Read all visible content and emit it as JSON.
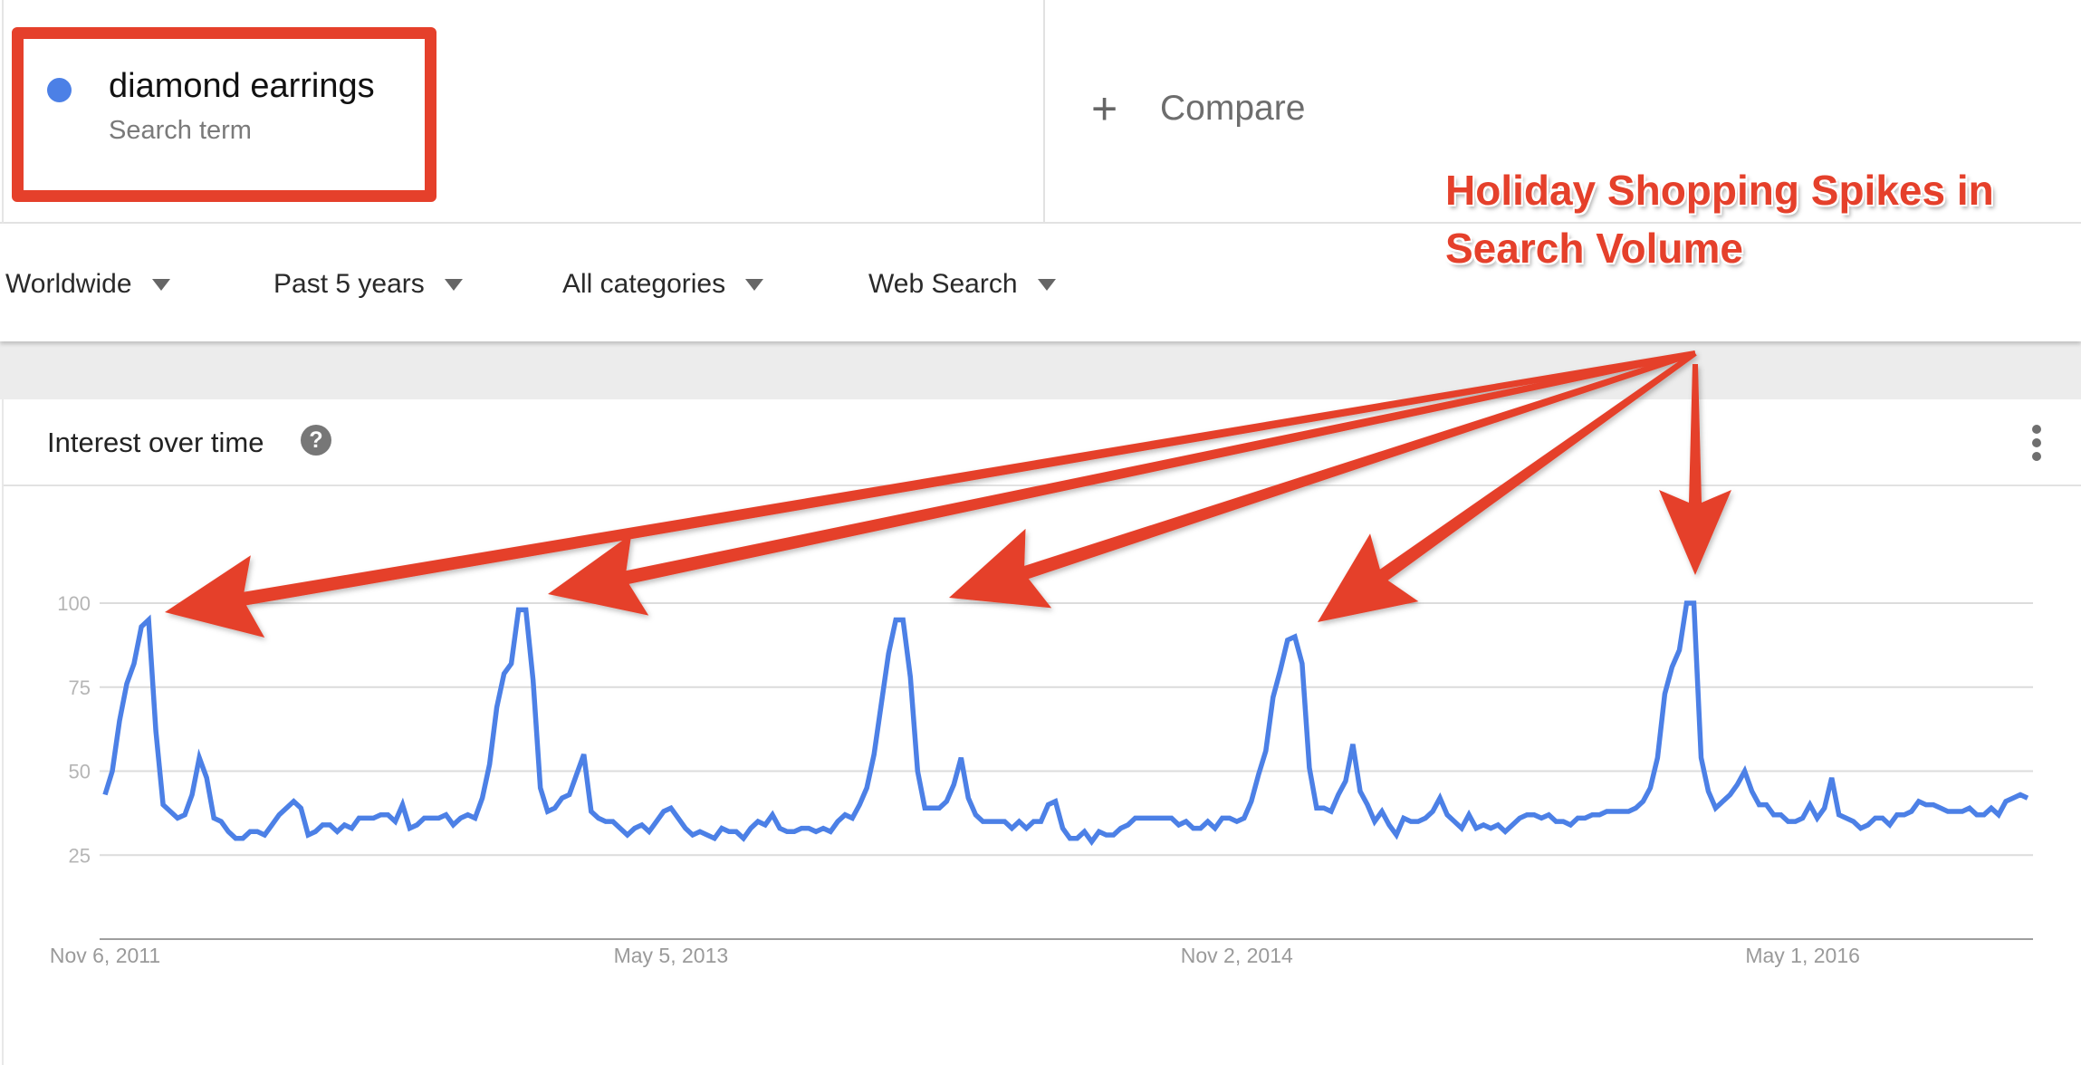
{
  "search_terms": [
    {
      "name": "diamond earrings",
      "type_label": "Search term",
      "color": "#4c80e6"
    }
  ],
  "compare": {
    "icon": "plus-icon",
    "label": "Compare"
  },
  "filters": [
    {
      "label": "Worldwide"
    },
    {
      "label": "Past 5 years"
    },
    {
      "label": "All categories"
    },
    {
      "label": "Web Search"
    }
  ],
  "card": {
    "title": "Interest over time",
    "help_icon": "?",
    "menu_icon": "kebab-menu-icon"
  },
  "annotation": {
    "lines": [
      "Holiday Shopping Spikes in",
      "Search Volume"
    ],
    "color": "#e5402b",
    "arrow_count": 5
  },
  "chart_data": {
    "type": "line",
    "title": "Interest over time",
    "xlabel": "",
    "ylabel": "",
    "ylim": [
      0,
      100
    ],
    "yticks": [
      25,
      50,
      75,
      100
    ],
    "ytick_labels": [
      "25",
      "50",
      "75",
      "100"
    ],
    "xtick_labels": [
      "Nov 6, 2011",
      "May 5, 2013",
      "Nov 2, 2014",
      "May 1, 2016"
    ],
    "xtick_index": [
      0,
      78,
      156,
      234
    ],
    "grid": true,
    "legend": "none",
    "x_start": "Nov 6, 2011",
    "interval": "weekly",
    "series": [
      {
        "name": "diamond earrings",
        "color": "#4c80e6",
        "values": [
          43,
          50,
          65,
          76,
          82,
          93,
          95,
          62,
          40,
          38,
          36,
          37,
          43,
          54,
          48,
          36,
          35,
          32,
          30,
          30,
          32,
          32,
          31,
          34,
          37,
          39,
          41,
          39,
          31,
          32,
          34,
          34,
          32,
          34,
          33,
          36,
          36,
          36,
          37,
          37,
          35,
          40,
          33,
          34,
          36,
          36,
          36,
          37,
          34,
          36,
          37,
          36,
          42,
          52,
          69,
          79,
          82,
          98,
          98,
          77,
          45,
          38,
          39,
          42,
          43,
          49,
          55,
          38,
          36,
          35,
          35,
          33,
          31,
          33,
          34,
          32,
          35,
          38,
          39,
          36,
          33,
          31,
          32,
          31,
          30,
          33,
          32,
          32,
          30,
          33,
          35,
          34,
          37,
          33,
          32,
          32,
          33,
          33,
          32,
          33,
          32,
          35,
          37,
          36,
          40,
          45,
          55,
          70,
          85,
          95,
          95,
          78,
          50,
          39,
          39,
          39,
          41,
          46,
          54,
          42,
          37,
          35,
          35,
          35,
          35,
          33,
          35,
          33,
          35,
          35,
          40,
          41,
          33,
          30,
          30,
          32,
          29,
          32,
          31,
          31,
          33,
          34,
          36,
          36,
          36,
          36,
          36,
          36,
          34,
          35,
          33,
          33,
          35,
          33,
          36,
          36,
          35,
          36,
          41,
          49,
          56,
          72,
          80,
          89,
          90,
          82,
          51,
          39,
          39,
          38,
          43,
          47,
          58,
          44,
          40,
          35,
          38,
          34,
          31,
          36,
          35,
          35,
          36,
          38,
          42,
          37,
          35,
          33,
          37,
          33,
          34,
          33,
          34,
          32,
          34,
          36,
          37,
          37,
          36,
          37,
          35,
          35,
          34,
          36,
          36,
          37,
          37,
          38,
          38,
          38,
          38,
          39,
          41,
          45,
          54,
          73,
          81,
          86,
          100,
          100,
          54,
          44,
          39,
          41,
          43,
          46,
          50,
          44,
          40,
          40,
          37,
          37,
          35,
          35,
          36,
          40,
          36,
          39,
          48,
          37,
          36,
          35,
          33,
          34,
          36,
          36,
          34,
          37,
          37,
          38,
          41,
          40,
          40,
          39,
          38,
          38,
          38,
          39,
          37,
          37,
          39,
          37,
          41,
          42,
          43,
          42
        ]
      }
    ]
  }
}
